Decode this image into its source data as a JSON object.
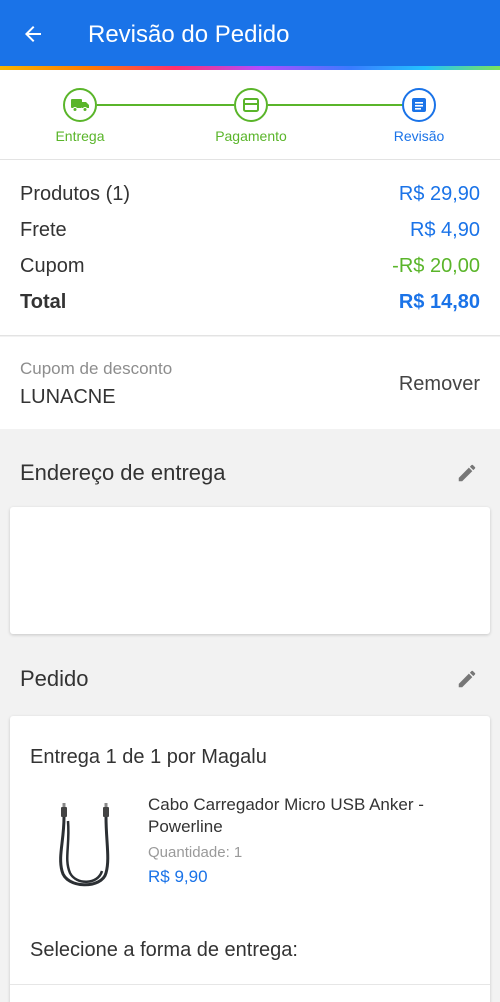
{
  "header": {
    "title": "Revisão do Pedido",
    "back_icon": "arrow-left-icon"
  },
  "stepper": {
    "steps": [
      {
        "label": "Entrega",
        "state": "done",
        "icon": "truck-icon"
      },
      {
        "label": "Pagamento",
        "state": "done",
        "icon": "card-icon"
      },
      {
        "label": "Revisão",
        "state": "active",
        "icon": "list-icon"
      }
    ]
  },
  "summary": {
    "products_label": "Produtos (1)",
    "products_value": "R$ 29,90",
    "shipping_label": "Frete",
    "shipping_value": "R$ 4,90",
    "coupon_label": "Cupom",
    "coupon_value": "-R$ 20,00",
    "total_label": "Total",
    "total_value": "R$ 14,80"
  },
  "coupon": {
    "caption": "Cupom de desconto",
    "code": "LUNACNE",
    "remove_label": "Remover"
  },
  "address": {
    "title": "Endereço de entrega"
  },
  "order": {
    "title": "Pedido",
    "delivery_header": "Entrega 1 de 1 por Magalu",
    "product_name": "Cabo Carregador Micro USB Anker - Powerline",
    "quantity_label": "Quantidade:",
    "quantity_value": "1",
    "price": "R$ 9,90",
    "select_delivery": "Selecione a forma de entrega:"
  },
  "colors": {
    "primary": "#1a73e8",
    "success": "#5ab52a"
  }
}
